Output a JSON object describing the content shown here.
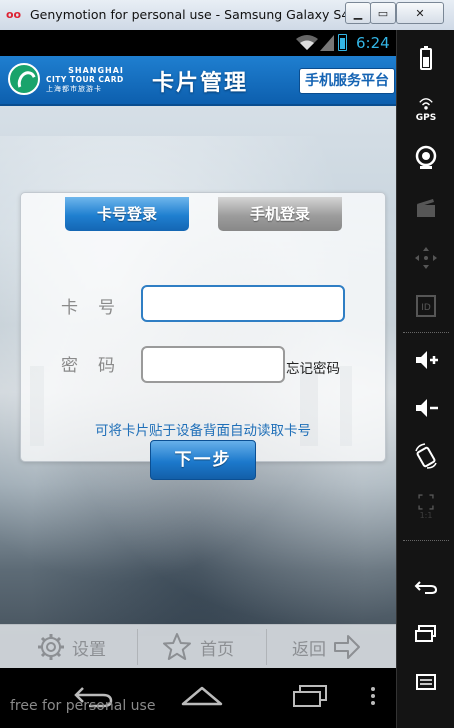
{
  "window": {
    "title": "Genymotion for personal use - Samsung Galaxy S4 - ...",
    "icon_glyph": "oo"
  },
  "status_bar": {
    "time": "6:24"
  },
  "app_header": {
    "brand_line1": "SHANGHAI",
    "brand_line2": "CITY TOUR CARD",
    "brand_line3": "上海都市旅游卡",
    "page_title": "卡片管理",
    "platform_label": "手机服务平台"
  },
  "login": {
    "tabs": [
      {
        "label": "卡号登录",
        "active": true
      },
      {
        "label": "手机登录",
        "active": false
      }
    ],
    "card_number_label": "卡号",
    "card_number_value": "",
    "password_label": "密码",
    "password_value": "",
    "forgot_password": "忘记密码",
    "hint": "可将卡片贴于设备背面自动读取卡号",
    "next_button": "下一步"
  },
  "bottom_nav": {
    "settings": "设置",
    "home": "首页",
    "back": "返回"
  },
  "watermark": "free for personal use",
  "side_panel": {
    "gps_label": "GPS",
    "zoom_label": "1:1"
  },
  "colors": {
    "accent": "#1f7fd0",
    "status_text": "#33b5e5",
    "hint_text": "#1f6fb8"
  }
}
